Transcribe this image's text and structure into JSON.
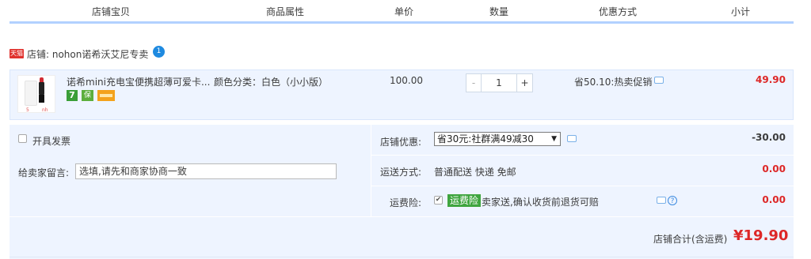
{
  "header": {
    "columns": [
      "店铺宝贝",
      "商品属性",
      "单价",
      "数量",
      "优惠方式",
      "小计"
    ]
  },
  "shop": {
    "badge": "天猫",
    "label": "店铺: nohon诺希沃艾尼专卖",
    "wangwang_glyph": "1"
  },
  "item": {
    "thumb_mark_left": "5",
    "thumb_mark_right": "nh",
    "title": "诺希mini充电宝便携超薄可爱卡...",
    "service_icons": [
      "7",
      "保",
      "card"
    ],
    "attribute": "颜色分类：白色（小小版）",
    "unit_price": "100.00",
    "quantity": "1",
    "qty_minus": "-",
    "qty_plus": "+",
    "promotion": "省50.10:热卖促销",
    "subtotal": "49.90"
  },
  "order": {
    "invoice_label": "开具发票",
    "message_label": "给卖家留言:",
    "message_value": "选填,请先和商家协商一致",
    "shop_discount_label": "店铺优惠:",
    "shop_discount_selected": "省30元:社群满49减30",
    "shop_discount_value": "-30.00",
    "shipping_label": "运送方式:",
    "shipping_text": "普通配送 快递 免邮",
    "shipping_value": "0.00",
    "insurance_label": "运费险:",
    "insurance_badge": "运费险",
    "insurance_text": "卖家送,确认收货前退货可赔",
    "insurance_value": "0.00",
    "help_glyph": "?",
    "checkmark": "✔",
    "select_arrow": "▼",
    "total_label": "店铺合计(含运费)",
    "total_value": "¥19.90"
  },
  "colors": {
    "accent_blue": "#b2d1ff",
    "price_red": "#dd2727",
    "row_bg": "#eef4ff"
  }
}
